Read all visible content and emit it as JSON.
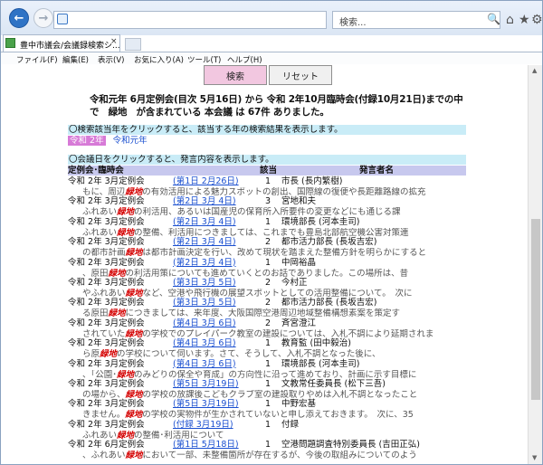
{
  "browser": {
    "address": "",
    "search_placeholder": "検索...",
    "tab_title": "豊中市議会/会議録検索シ...",
    "tab_close": "×",
    "back_icon": "←",
    "forward_icon": "→",
    "search_icon": "🔍",
    "home_icon": "⌂",
    "star_icon": "★",
    "gear_icon": "⚙"
  },
  "menu": [
    "ファイル(F)",
    "編集(E)",
    "表示(V)",
    "お気に入り(A)",
    "ツール(T)",
    "ヘルプ(H)"
  ],
  "buttons": {
    "search": "検索",
    "reset": "リセット"
  },
  "summary": "令和元年 6月定例会(目次 5月16日) から 令和 2年10月臨時会(付録10月21日)までの中で　緑地　が含まれている 本会議 は 67件 ありました。",
  "instr_year": "〇検索該当年をクリックすると、該当する年の検索結果を表示します。",
  "years": {
    "selected": "令和 2年",
    "other": "令和元年"
  },
  "instr_session": "〇会議日をクリックすると、発言内容を表示します。",
  "headers": {
    "session": "定例会･臨時会",
    "hit": "該当",
    "speaker": "発言者名"
  },
  "keyword": "緑地",
  "rows": [
    {
      "session": "令和 2年 3月定例会",
      "date": "(第1日 2月26日)",
      "count": "1",
      "speaker": "市長 (長内繁樹)",
      "pre": "もに、周辺",
      "post": "の有効活用による魅力スポットの創出、国際線の復便や長距離路線の拡充"
    },
    {
      "session": "令和 2年 3月定例会",
      "date": "(第2日 3月 4日)",
      "count": "3",
      "speaker": "宮地和夫",
      "pre": "ふれあい",
      "post": "の利活用、あるいは国産児の保育所入所要件の変更などにも通じる課"
    },
    {
      "session": "令和 2年 3月定例会",
      "date": "(第2日 3月 4日)",
      "count": "1",
      "speaker": "環境部長 (河本圭司)",
      "pre": "ふれあい",
      "post": "の整備、利活用につきましては、これまでも豊島北部航空機公害対策連"
    },
    {
      "session": "令和 2年 3月定例会",
      "date": "(第2日 3月 4日)",
      "count": "2",
      "speaker": "都市活力部長 (長坂吉宏)",
      "pre": "の都市計画",
      "post": "は都市計画決定を行い、改めて現状を踏まえた整備方針を明らかにすると"
    },
    {
      "session": "令和 2年 3月定例会",
      "date": "(第2日 3月 4日)",
      "count": "1",
      "speaker": "中岡裕晶",
      "pre": "、原田",
      "post": "の利活用策についても進めていくとのお話でありました。この場所は、昔"
    },
    {
      "session": "令和 2年 3月定例会",
      "date": "(第3日 3月 5日)",
      "count": "2",
      "speaker": "今村正",
      "pre": "やふれあい",
      "post": "など、空港や飛行機の展望スポットとしての活用整備について。　次に"
    },
    {
      "session": "令和 2年 3月定例会",
      "date": "(第3日 3月 5日)",
      "count": "2",
      "speaker": "都市活力部長 (長坂吉宏)",
      "pre": "る原田",
      "post": "につきましては、来年度、大阪国際空港周辺地域整備構想素案を策定す"
    },
    {
      "session": "令和 2年 3月定例会",
      "date": "(第4日 3月 6日)",
      "count": "2",
      "speaker": "斉宮澄江",
      "pre": "されていた",
      "post": "の学校でのプレイパーク教室の建設については、入札不調により延期されま"
    },
    {
      "session": "令和 2年 3月定例会",
      "date": "(第4日 3月 6日)",
      "count": "1",
      "speaker": "教育監 (田中毅治)",
      "pre": "ら原",
      "post": "の学校について伺います。さて、そうして、入札不調となった後に、"
    },
    {
      "session": "令和 2年 3月定例会",
      "date": "(第4日 3月 6日)",
      "count": "1",
      "speaker": "環境部長 (河本圭司)",
      "pre": "、「公園･",
      "post": "のみどりの保全や育成」の方向性に沿って進めており、計画に示す目標に"
    },
    {
      "session": "令和 2年 3月定例会",
      "date": "(第5日 3月19日)",
      "count": "1",
      "speaker": "文教常任委員長 (松下三吾)",
      "pre": "の場から、",
      "post": "の学校の放課後こどもクラブ室の建設取りやめは入札不調となったこと"
    },
    {
      "session": "令和 2年 3月定例会",
      "date": "(第5日 3月19日)",
      "count": "1",
      "speaker": "中野宏基",
      "pre": "きません。",
      "post": "の学校の実物件が生かされていないと申し添えておきます。　次に、35"
    },
    {
      "session": "令和 2年 3月定例会",
      "date": "(付録 3月19日)",
      "count": "1",
      "speaker": "付録",
      "pre": "ふれあい",
      "post": "の整備･利活用について"
    },
    {
      "session": "令和 2年 6月定例会",
      "date": "(第1日 5月18日)",
      "count": "1",
      "speaker": "空港問題調査特別委員長 (吉田正弘)",
      "pre": "、ふれあい",
      "post": "において一部、未整備箇所が存在するが、今後の取組みについてのよう"
    }
  ]
}
